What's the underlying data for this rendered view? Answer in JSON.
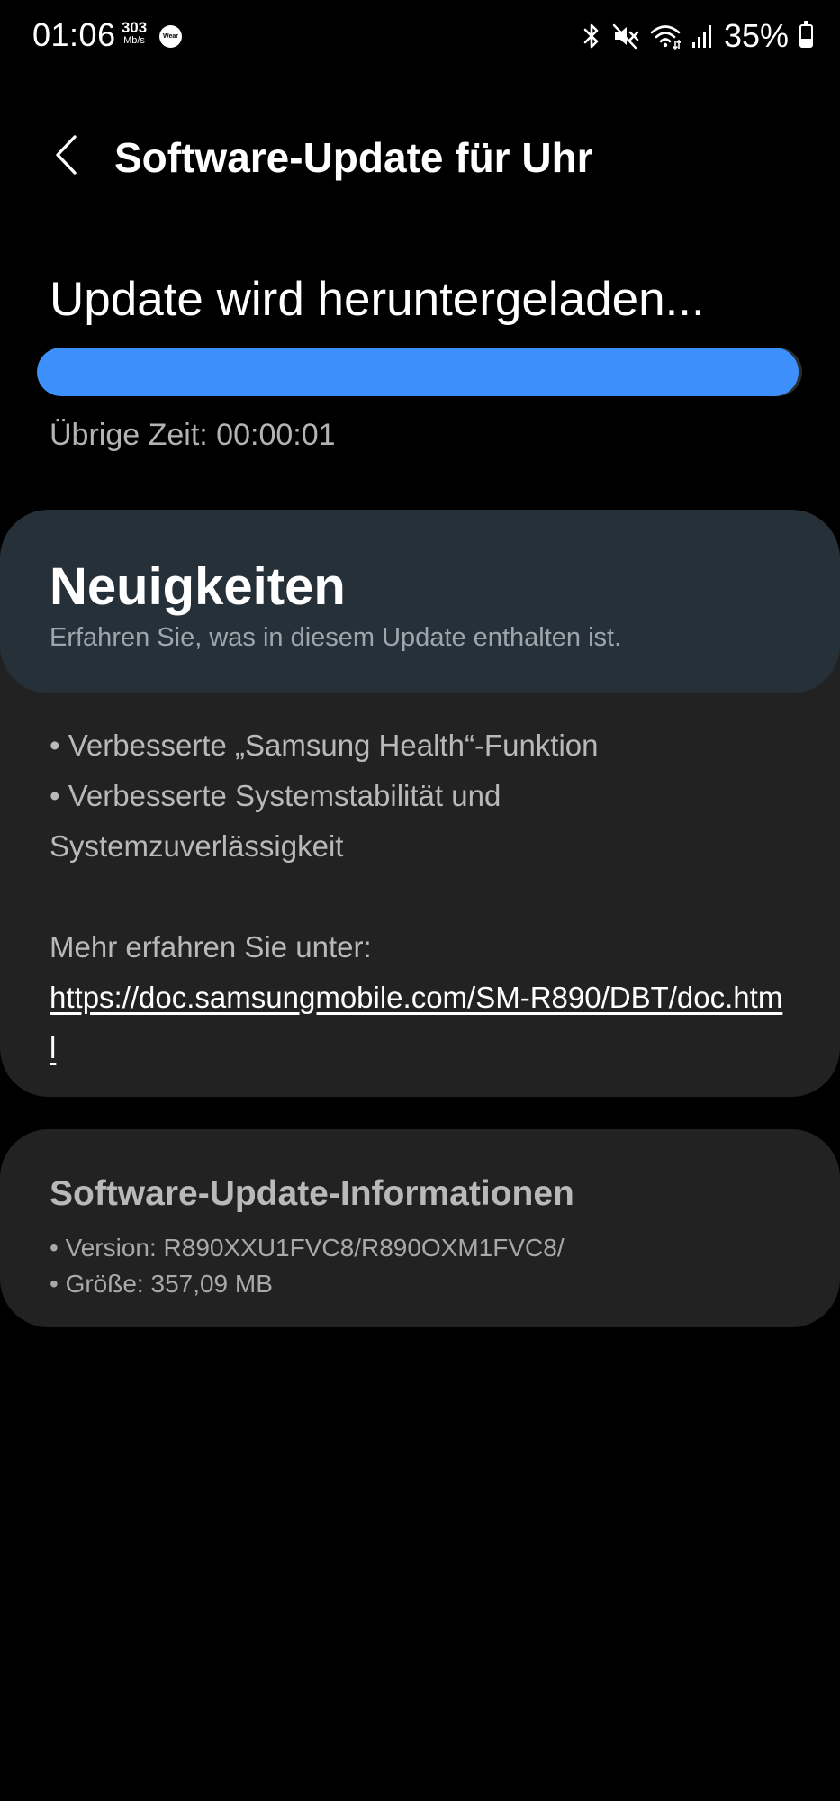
{
  "status_bar": {
    "time": "01:06",
    "speed_value": "303",
    "speed_unit": "Mb/s",
    "wear_label": "Wear",
    "battery_percent": "35%",
    "battery_level": 0.35,
    "icons": [
      "bluetooth-icon",
      "mute-icon",
      "wifi-icon",
      "signal-icon",
      "battery-icon"
    ]
  },
  "header": {
    "back_icon": "chevron-left-icon",
    "title": "Software-Update für Uhr"
  },
  "download": {
    "title": "Update wird heruntergeladen...",
    "progress": 0.995,
    "remaining_label": "Übrige Zeit: 00:00:01"
  },
  "news": {
    "title": "Neuigkeiten",
    "subtitle": "Erfahren Sie, was in diesem Update enthalten ist.",
    "items": [
      "• Verbesserte „Samsung Health“-Funktion",
      "• Verbesserte Systemstabilität und",
      "Systemzuverlässigkeit"
    ],
    "more_label": "Mehr erfahren Sie unter:",
    "link": "https://doc.samsungmobile.com/SM-R890/DBT/doc.html"
  },
  "info": {
    "title": "Software-Update-Informationen",
    "version": "• Version: R890XXU1FVC8/R890OXM1FVC8/",
    "size": "• Größe: 357,09 MB"
  },
  "colors": {
    "background": "#000000",
    "accent": "#3d8ffb",
    "card": "#222222",
    "news_header": "#253039"
  }
}
